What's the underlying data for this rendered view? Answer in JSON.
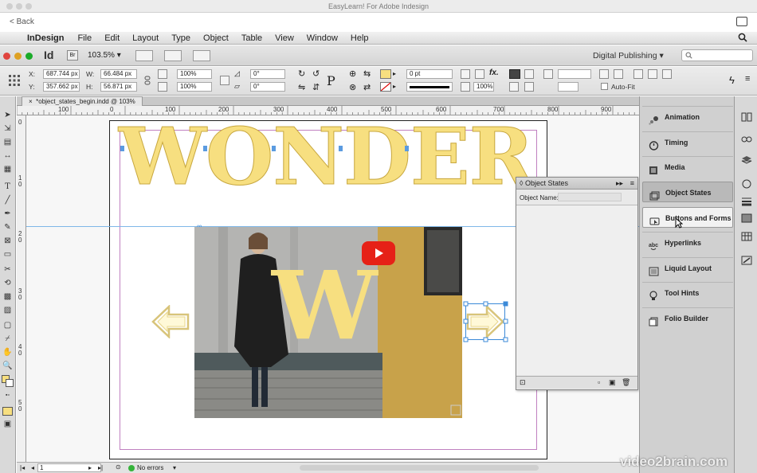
{
  "outer": {
    "title": "EasyLearn! For Adobe Indesign",
    "back_label": "< Back"
  },
  "menubar": {
    "app_name": "InDesign",
    "items": [
      "File",
      "Edit",
      "Layout",
      "Type",
      "Object",
      "Table",
      "View",
      "Window",
      "Help"
    ]
  },
  "appbar": {
    "logo": "Id",
    "bridge": "Br",
    "zoom": "103.5%",
    "workspace": "Digital Publishing",
    "search_placeholder": "🔍"
  },
  "control": {
    "x_label": "X:",
    "x_value": "687.744 px",
    "y_label": "Y:",
    "y_value": "357.662 px",
    "w_label": "W:",
    "w_value": "66.484 px",
    "h_label": "H:",
    "h_value": "56.871 px",
    "scale_x": "100%",
    "scale_y": "100%",
    "rotate": "0°",
    "shear": "0°",
    "stroke_weight": "0 pt",
    "opacity": "100%",
    "autofit": "Auto-Fit"
  },
  "document": {
    "tab": "*object_states_begin.indd @ 103%",
    "ruler_h": [
      "0",
      "100",
      "200",
      "300",
      "400",
      "500",
      "600",
      "700",
      "800",
      "900"
    ],
    "ruler_v": [
      "0",
      "1",
      "0",
      "2",
      "0",
      "3",
      "0",
      "4",
      "0",
      "5",
      "0"
    ],
    "headline": "WONDER",
    "letter": "W"
  },
  "status": {
    "page": "1",
    "preflight": "No errors"
  },
  "object_states": {
    "title": "Object States",
    "object_name_label": "Object Name:"
  },
  "dock": {
    "items": [
      {
        "label": "Animation",
        "icon": "animation-icon"
      },
      {
        "label": "Timing",
        "icon": "timing-icon"
      },
      {
        "label": "Media",
        "icon": "media-icon"
      },
      {
        "label": "Object States",
        "icon": "object-states-icon"
      },
      {
        "label": "Buttons and Forms",
        "icon": "buttons-forms-icon"
      },
      {
        "label": "Hyperlinks",
        "icon": "hyperlinks-icon"
      },
      {
        "label": "Liquid Layout",
        "icon": "liquid-layout-icon"
      },
      {
        "label": "Tool Hints",
        "icon": "tool-hints-icon"
      },
      {
        "label": "Folio Builder",
        "icon": "folio-builder-icon"
      }
    ]
  },
  "watermark": "video2brain.com",
  "colors": {
    "yellow": "#f7df80",
    "youtube_red": "#e62117",
    "guide_blue": "#7fb7e8",
    "selection_blue": "#3b8ad8"
  }
}
